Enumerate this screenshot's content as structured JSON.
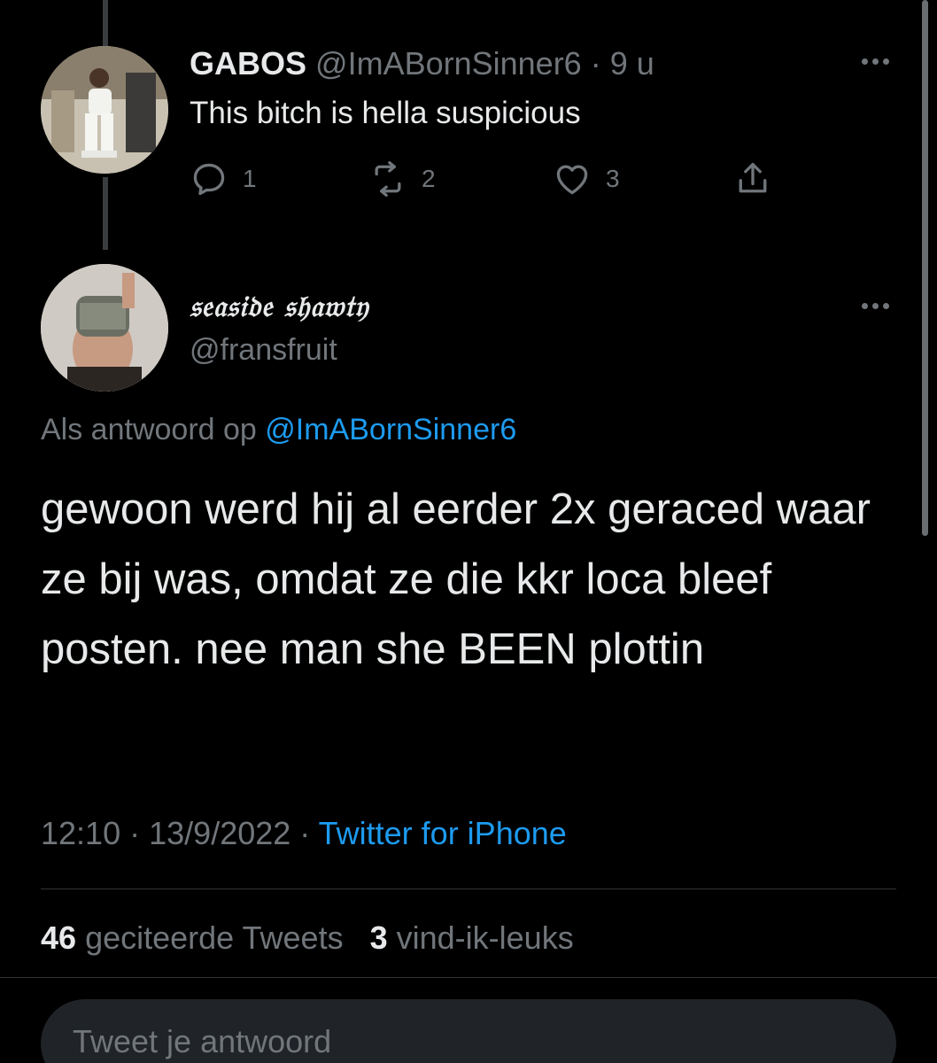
{
  "parent_tweet": {
    "display_name": "GABOS",
    "handle": "@ImABornSinner6",
    "separator": "·",
    "time_ago": "9 u",
    "text": "This bitch is hella suspicious",
    "replies": "1",
    "retweets": "2",
    "likes": "3"
  },
  "main_tweet": {
    "display_name": "𝔰𝔢𝔞𝔰𝔦𝔡𝔢 𝔰𝔥𝔞𝔴𝔱𝔶",
    "handle": "@fransfruit",
    "reply_prefix": "Als antwoord op",
    "reply_handle": "@ImABornSinner6",
    "text": "gewoon werd hij al eerder 2x geraced waar ze bij was, omdat ze die kkr loca bleef posten. nee man she BEEN plottin",
    "time": "12:10",
    "date": "13/9/2022",
    "separator": "·",
    "source": "Twitter for iPhone"
  },
  "stats": {
    "quote_count": "46",
    "quote_label": "geciteerde Tweets",
    "like_count": "3",
    "like_label": "vind-ik-leuks"
  },
  "reply_input": {
    "placeholder": "Tweet je antwoord"
  },
  "colors": {
    "background": "#000000",
    "text": "#e7e9ea",
    "secondary": "#71767b",
    "accent": "#1d9bf0"
  }
}
